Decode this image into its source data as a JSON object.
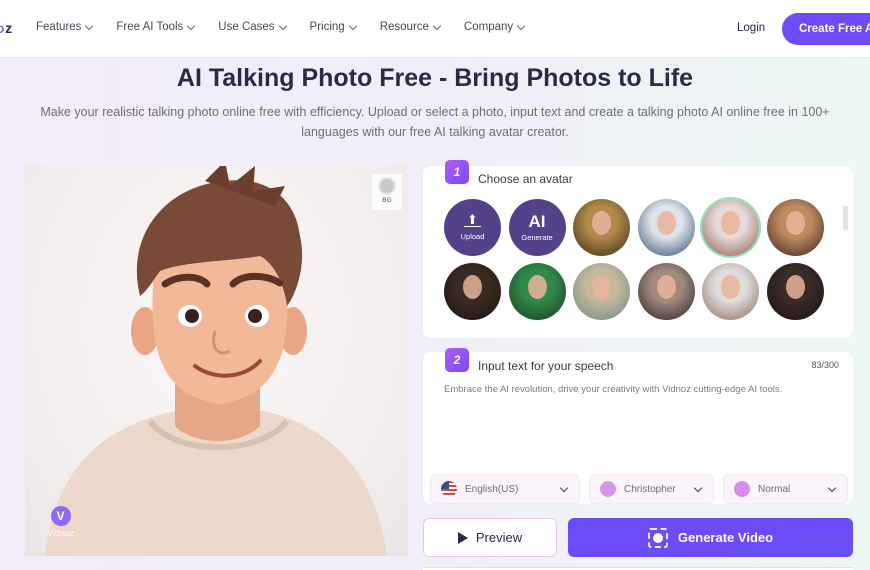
{
  "nav": {
    "logo_partial": "oz",
    "menu": [
      {
        "label": "Features"
      },
      {
        "label": "Free AI Tools"
      },
      {
        "label": "Use Cases"
      },
      {
        "label": "Pricing"
      },
      {
        "label": "Resource"
      },
      {
        "label": "Company"
      }
    ],
    "login": "Login",
    "cta": "Create Free A"
  },
  "hero": {
    "title": "AI Talking Photo Free - Bring Photos to Life",
    "subtitle": "Make your realistic talking photo online free with efficiency. Upload or select a photo, input text and create a talking photo AI online free in 100+ languages with our free AI talking avatar creator."
  },
  "preview": {
    "bg_label": "BG",
    "watermark": "Vidnoz",
    "watermark_mark": "V"
  },
  "step1": {
    "number": "1",
    "title": "Choose an avatar",
    "upload_label": "Upload",
    "generate_big": "AI",
    "generate_label": "Generate",
    "avatars": [
      {
        "name": "mona-lisa",
        "colors": [
          "#b08a4a",
          "#3a2a14"
        ]
      },
      {
        "name": "einstein",
        "colors": [
          "#dfe4ea",
          "#2b4a6e"
        ]
      },
      {
        "name": "cartoon-man-selected",
        "colors": [
          "#e8d9d8",
          "#8a5a48"
        ],
        "selected": true
      },
      {
        "name": "cartoon-woman",
        "colors": [
          "#c08a60",
          "#3a2420"
        ]
      },
      {
        "name": "shakespeare",
        "colors": [
          "#3a2a22",
          "#1a1410"
        ]
      },
      {
        "name": "frida",
        "colors": [
          "#2f8a4a",
          "#1c3a24"
        ]
      },
      {
        "name": "lady-hat",
        "colors": [
          "#c6b89a",
          "#6a8a8a"
        ]
      },
      {
        "name": "woman-black-hat",
        "colors": [
          "#a08a80",
          "#2a2020"
        ]
      },
      {
        "name": "cartoon-boy",
        "colors": [
          "#e0dcdc",
          "#8a6a58"
        ]
      },
      {
        "name": "wonder-woman",
        "colors": [
          "#3a2a28",
          "#1a1210"
        ]
      }
    ]
  },
  "step2": {
    "number": "2",
    "title": "Input text for your speech",
    "char_count": "83/300",
    "text": "Embrace the AI revolution, drive your creativity with Vidnoz cutting-edge AI tools.",
    "language": "English(US)",
    "voice": "Christopher",
    "emotion": "Normal"
  },
  "actions": {
    "preview": "Preview",
    "generate": "Generate Video"
  },
  "colors": {
    "accent": "#6b4cf6",
    "upload_bg": "#55418a",
    "selected_ring": "#8ee3b8"
  }
}
